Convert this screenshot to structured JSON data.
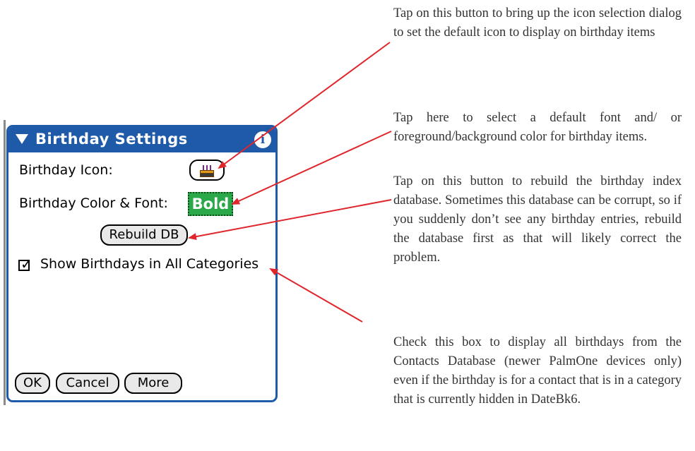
{
  "dialog": {
    "title": "Birthday Settings",
    "info_icon": "i",
    "birthday_icon_label": "Birthday Icon:",
    "color_font_label": "Birthday Color & Font:",
    "bold_button": "Bold",
    "rebuild_button": "Rebuild DB",
    "show_all_label": "Show Birthdays in All Categories",
    "show_all_checked": true,
    "buttons": {
      "ok": "OK",
      "cancel": "Cancel",
      "more": "More"
    },
    "accent_color": "#1e5aa8",
    "bold_color": "#2aa84a",
    "icons": [
      "menu-triangle-icon",
      "info-icon",
      "birthday-cake-icon",
      "checkbox-checked-icon"
    ]
  },
  "annotations": [
    "Tap on this button to bring up the icon selection dialog to set the default icon to display on birthday items",
    "Tap here to select a default font and/ or foreground/background color for birthday items.",
    "Tap on this button to rebuild the birthday index database. Sometimes this database can be corrupt, so if you suddenly don’t see any birthday entries, rebuild the database first as that will likely correct the problem.",
    "Check this box to display all birthdays from the Contacts Database (newer PalmOne devices only) even if the birthday is for a contact that is in a category that is currently hidden in DateBk6."
  ],
  "arrow_color": "#e0262b"
}
